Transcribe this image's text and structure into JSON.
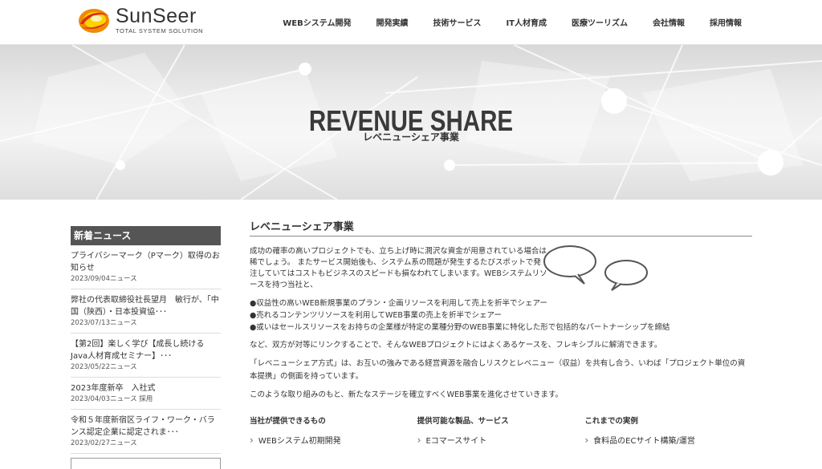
{
  "brand": {
    "name": "SunSeer",
    "tagline": "TOTAL SYSTEM SOLUTION",
    "colors": {
      "accent_orange": "#f08a00",
      "accent_red": "#d9301f",
      "accent_yellow": "#ffd200"
    }
  },
  "nav": [
    "WEBシステム開発",
    "開発実績",
    "技術サービス",
    "IT人材育成",
    "医療ツーリズム",
    "会社情報",
    "採用情報"
  ],
  "hero": {
    "title": "REVENUE SHARE",
    "subtitle": "レベニューシェア事業"
  },
  "sidebar": {
    "heading": "新着ニュース",
    "news": [
      {
        "title": "プライバシーマーク（Pマーク）取得のお知らせ",
        "meta": "2023/09/04ニュース"
      },
      {
        "title": "弊社の代表取締役社長望月　敏行が、「中国（陝西）・日本投資協･･･",
        "meta": "2023/07/13ニュース"
      },
      {
        "title": "【第2回】楽しく学び【成長し続けるJava人材育成セミナー】･･･",
        "meta": "2023/05/22ニュース"
      },
      {
        "title": "2023年度新卒　入社式",
        "meta": "2023/04/03ニュース 採用"
      },
      {
        "title": "令和５年度新宿区ライフ・ワーク・バランス認定企業に認定されま･･･",
        "meta": "2023/02/27ニュース"
      }
    ]
  },
  "main": {
    "title": "レベニューシェア事業",
    "intro": "成功の確率の高いプロジェクトでも、立ち上げ時に潤沢な資金が用意されている場合は稀でしょう。 またサービス開始後も、システム系の問題が発生するたびスポットで発注していてはコストもビジネスのスピードも損なわれてしまいます。WEBシステムリソースを持つ当社と、",
    "bullets": [
      "●収益性の高いWEB新規事業のプラン・企画リソースを利用して売上を折半でシェアー",
      "●売れるコンテンツリソースを利用してWEB事業の売上を折半でシェアー",
      "●或いはセールスリソースをお持ちの企業様が特定の業種分野のWEB事業に特化した形で包括的なパートナーシップを締結"
    ],
    "para1": "など、双方が対等にリンクすることで、そんなWEBプロジェクトにはよくあるケースを、フレキシブルに解消できます。",
    "para2": "「レベニューシェア方式」は、お互いの強みである経営資源を融合しリスクとレベニュー（収益）を共有し合う、いわば「プロジェクト単位の資本提携」の側面を持っています。",
    "para3": "このような取り組みのもと、新たなステージを確立すべくWEB事業を進化させていきます。",
    "columns": [
      {
        "heading": "当社が提供できるもの",
        "items": [
          "WEBシステム初期開発"
        ]
      },
      {
        "heading": "提供可能な製品、サービス",
        "items": [
          "Eコマースサイト"
        ]
      },
      {
        "heading": "これまでの実例",
        "items": [
          "食料品のECサイト構築/運営"
        ]
      }
    ]
  }
}
